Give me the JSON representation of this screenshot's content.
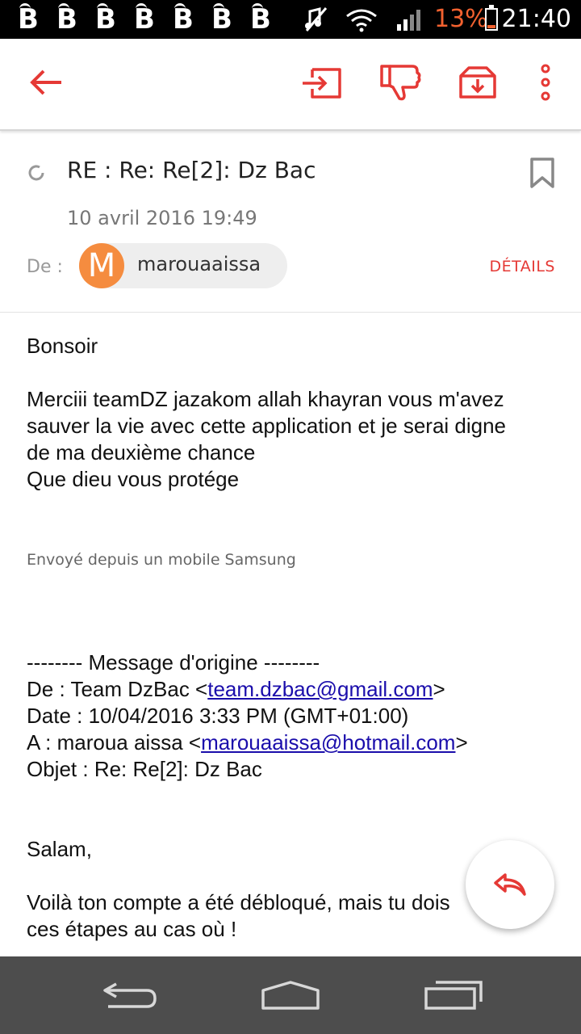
{
  "status_bar": {
    "notification_glyphs": [
      "B",
      "B",
      "B",
      "B",
      "B",
      "B",
      "B"
    ],
    "battery_percent": "13%",
    "time": "21:40",
    "colors": {
      "battery": "#f2612f"
    },
    "icons": [
      "mute-icon",
      "wifi-icon",
      "signal-icon",
      "battery-icon"
    ]
  },
  "toolbar": {
    "accent_color": "#e53935",
    "icons": [
      "back-arrow-icon",
      "move-to-icon",
      "mark-spam-icon",
      "archive-icon",
      "more-vert-icon"
    ]
  },
  "email": {
    "subject": "RE : Re: Re[2]: Dz Bac",
    "date": "10 avril 2016 19:49",
    "from_label": "De :",
    "sender_initial": "M",
    "sender_name": "marouaaissa",
    "details_label": "DÉTAILS",
    "avatar_color": "#f58c3f"
  },
  "body": {
    "greeting": "Bonsoir",
    "message_lines": [
      "Merciii teamDZ jazakom allah khayran vous m'avez",
      "sauver la vie avec cette application et je serai digne",
      "de ma deuxième chance",
      "Que dieu vous protége"
    ],
    "signature": "Envoyé depuis un mobile Samsung",
    "original_header": "-------- Message d'origine --------",
    "orig_from_prefix": "De : Team DzBac <",
    "orig_from_email": "team.dzbac@gmail.com",
    "orig_from_suffix": ">",
    "orig_date": "Date : 10/04/2016 3:33 PM (GMT+01:00)",
    "orig_to_prefix": "A : maroua aissa <",
    "orig_to_email": "marouaaissa@hotmail.com",
    "orig_to_suffix": ">",
    "orig_subject": "Objet : Re: Re[2]: Dz Bac",
    "salam": "Salam,",
    "reply_line1": "Voilà ton compte a été débloqué, mais tu dois",
    "reply_line2": "ces étapes au cas où !"
  },
  "fab": {
    "icon": "reply-icon"
  },
  "nav_bar": {
    "icons": [
      "nav-back-icon",
      "nav-home-icon",
      "nav-recents-icon"
    ]
  }
}
